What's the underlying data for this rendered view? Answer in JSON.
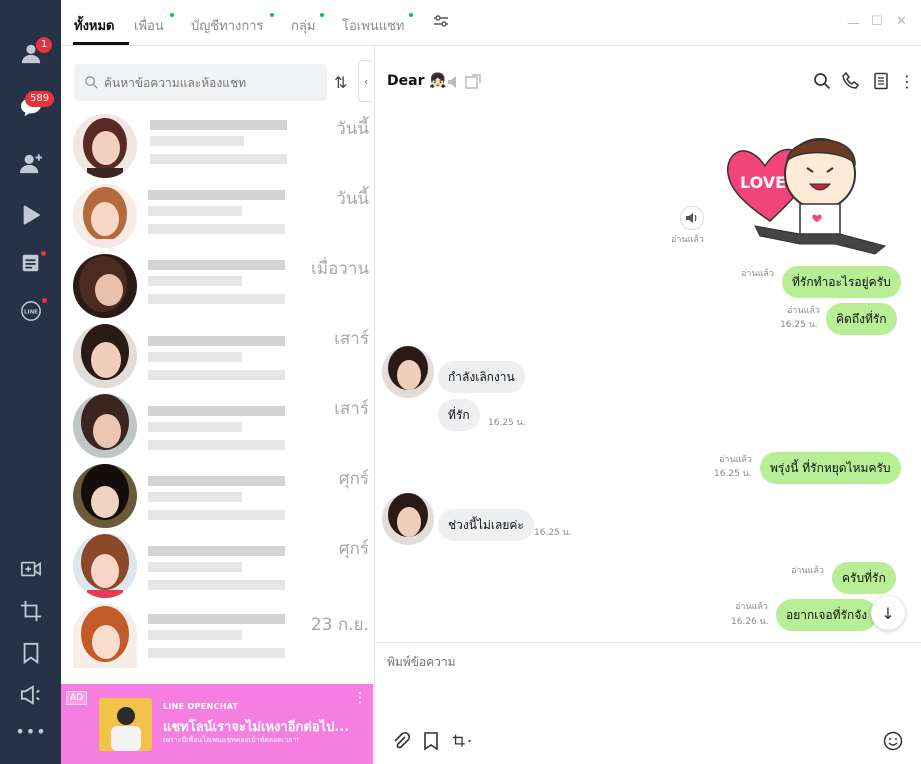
{
  "rail": {
    "friends_badge": "1",
    "chats_badge": "589"
  },
  "tabs": [
    {
      "label": "ทั้งหมด"
    },
    {
      "label": "เพื่อน"
    },
    {
      "label": "บัญชีทางการ"
    },
    {
      "label": "กลุ่ม"
    },
    {
      "label": "โอเพนแชท"
    }
  ],
  "search": {
    "placeholder": "ค้นหาข้อความและห้องแชท"
  },
  "chat_list": [
    {
      "date": "วันนี้"
    },
    {
      "date": "วันนี้"
    },
    {
      "date": "เมื่อวาน"
    },
    {
      "date": "เสาร์"
    },
    {
      "date": "เสาร์"
    },
    {
      "date": "ศุกร์"
    },
    {
      "date": "ศุกร์"
    },
    {
      "date": "23 ก.ย."
    }
  ],
  "ad": {
    "tag": "AD",
    "brand": "LINE OPENCHAT",
    "title": "แชทโลน์เราจะไม่เหงาอีกต่อไป...",
    "subtitle": "เพราะมีเพื่อนโอเพนแชทคอยเม้าท์ตลอดเวลา!"
  },
  "chat": {
    "title": "Dear",
    "title_emoji": "👧🏻",
    "sticker_text": "LOVE",
    "sticker_read": "อ่านแล้ว",
    "messages": [
      {
        "text": "ที่รักทำอะไรอยู่ครับ",
        "read": "อ่านแล้ว",
        "time": ""
      },
      {
        "text": "คิดถึงที่รัก",
        "read": "อ่านแล้ว",
        "time": "16.25 น."
      },
      {
        "text": "กำลังเลิกงาน",
        "time": ""
      },
      {
        "text": "ที่รัก",
        "time": "16.25 น."
      },
      {
        "text": "พรุ่งนี้ ที่รักหยุดไหมครับ",
        "read": "อ่านแล้ว",
        "time": "16.25 น."
      },
      {
        "text": "ช่วงนี้ไม่เลยค่ะ",
        "time": "16.25 น."
      },
      {
        "text": "ครับที่รัก",
        "read": "อ่านแล้ว",
        "time": ""
      },
      {
        "text": "อยากเจอที่รักจัง",
        "read": "อ่านแล้ว",
        "time": "16.26 น."
      }
    ],
    "composer_placeholder": "พิมพ์ข้อความ"
  }
}
